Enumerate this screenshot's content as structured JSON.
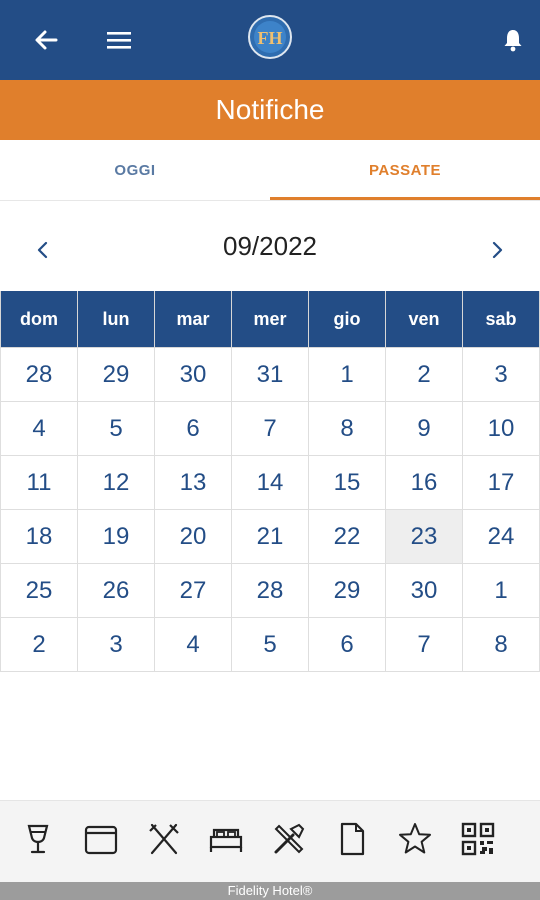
{
  "header": {
    "logo_text": "FH",
    "back_icon": "arrow-left-icon",
    "menu_icon": "hamburger-menu-icon",
    "bell_icon": "bell-icon"
  },
  "page_title": "Notifiche",
  "tabs": [
    {
      "label": "OGGI",
      "active": false
    },
    {
      "label": "PASSATE",
      "active": true
    }
  ],
  "calendar": {
    "month_label": "09/2022",
    "weekdays": [
      "dom",
      "lun",
      "mar",
      "mer",
      "gio",
      "ven",
      "sab"
    ],
    "weeks": [
      [
        "28",
        "29",
        "30",
        "31",
        "1",
        "2",
        "3"
      ],
      [
        "4",
        "5",
        "6",
        "7",
        "8",
        "9",
        "10"
      ],
      [
        "11",
        "12",
        "13",
        "14",
        "15",
        "16",
        "17"
      ],
      [
        "18",
        "19",
        "20",
        "21",
        "22",
        "23",
        "24"
      ],
      [
        "25",
        "26",
        "27",
        "28",
        "29",
        "30",
        "1"
      ],
      [
        "2",
        "3",
        "4",
        "5",
        "6",
        "7",
        "8"
      ]
    ],
    "selected_day": "23"
  },
  "bottom_nav": [
    "wine-glass-icon",
    "calendar-icon",
    "restaurant-icon",
    "bed-icon",
    "tools-icon",
    "document-icon",
    "star-icon",
    "qr-code-icon"
  ],
  "footer": "Fidelity Hotel®",
  "colors": {
    "primary": "#234d86",
    "accent": "#e07f2c"
  }
}
